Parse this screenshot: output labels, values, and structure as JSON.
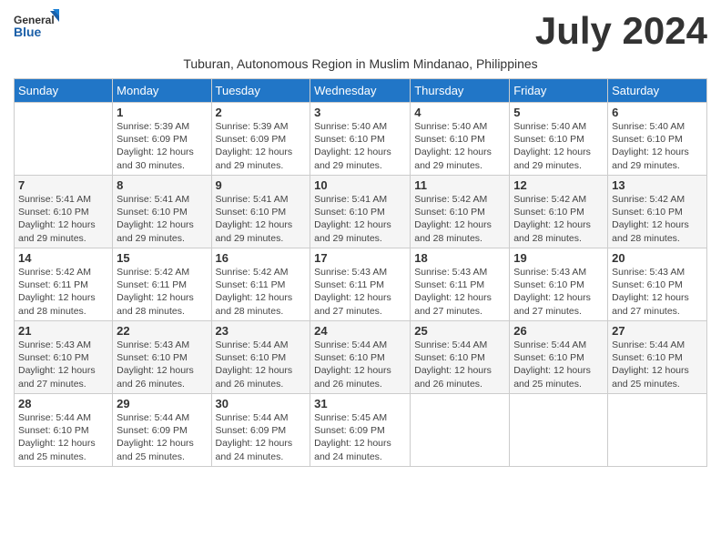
{
  "header": {
    "logo_line1": "General",
    "logo_line2": "Blue",
    "month_title": "July 2024",
    "subtitle": "Tuburan, Autonomous Region in Muslim Mindanao, Philippines"
  },
  "days_of_week": [
    "Sunday",
    "Monday",
    "Tuesday",
    "Wednesday",
    "Thursday",
    "Friday",
    "Saturday"
  ],
  "weeks": [
    [
      {
        "day": "",
        "info": ""
      },
      {
        "day": "1",
        "info": "Sunrise: 5:39 AM\nSunset: 6:09 PM\nDaylight: 12 hours\nand 30 minutes."
      },
      {
        "day": "2",
        "info": "Sunrise: 5:39 AM\nSunset: 6:09 PM\nDaylight: 12 hours\nand 29 minutes."
      },
      {
        "day": "3",
        "info": "Sunrise: 5:40 AM\nSunset: 6:10 PM\nDaylight: 12 hours\nand 29 minutes."
      },
      {
        "day": "4",
        "info": "Sunrise: 5:40 AM\nSunset: 6:10 PM\nDaylight: 12 hours\nand 29 minutes."
      },
      {
        "day": "5",
        "info": "Sunrise: 5:40 AM\nSunset: 6:10 PM\nDaylight: 12 hours\nand 29 minutes."
      },
      {
        "day": "6",
        "info": "Sunrise: 5:40 AM\nSunset: 6:10 PM\nDaylight: 12 hours\nand 29 minutes."
      }
    ],
    [
      {
        "day": "7",
        "info": "Sunrise: 5:41 AM\nSunset: 6:10 PM\nDaylight: 12 hours\nand 29 minutes."
      },
      {
        "day": "8",
        "info": "Sunrise: 5:41 AM\nSunset: 6:10 PM\nDaylight: 12 hours\nand 29 minutes."
      },
      {
        "day": "9",
        "info": "Sunrise: 5:41 AM\nSunset: 6:10 PM\nDaylight: 12 hours\nand 29 minutes."
      },
      {
        "day": "10",
        "info": "Sunrise: 5:41 AM\nSunset: 6:10 PM\nDaylight: 12 hours\nand 29 minutes."
      },
      {
        "day": "11",
        "info": "Sunrise: 5:42 AM\nSunset: 6:10 PM\nDaylight: 12 hours\nand 28 minutes."
      },
      {
        "day": "12",
        "info": "Sunrise: 5:42 AM\nSunset: 6:10 PM\nDaylight: 12 hours\nand 28 minutes."
      },
      {
        "day": "13",
        "info": "Sunrise: 5:42 AM\nSunset: 6:10 PM\nDaylight: 12 hours\nand 28 minutes."
      }
    ],
    [
      {
        "day": "14",
        "info": "Sunrise: 5:42 AM\nSunset: 6:11 PM\nDaylight: 12 hours\nand 28 minutes."
      },
      {
        "day": "15",
        "info": "Sunrise: 5:42 AM\nSunset: 6:11 PM\nDaylight: 12 hours\nand 28 minutes."
      },
      {
        "day": "16",
        "info": "Sunrise: 5:42 AM\nSunset: 6:11 PM\nDaylight: 12 hours\nand 28 minutes."
      },
      {
        "day": "17",
        "info": "Sunrise: 5:43 AM\nSunset: 6:11 PM\nDaylight: 12 hours\nand 27 minutes."
      },
      {
        "day": "18",
        "info": "Sunrise: 5:43 AM\nSunset: 6:11 PM\nDaylight: 12 hours\nand 27 minutes."
      },
      {
        "day": "19",
        "info": "Sunrise: 5:43 AM\nSunset: 6:10 PM\nDaylight: 12 hours\nand 27 minutes."
      },
      {
        "day": "20",
        "info": "Sunrise: 5:43 AM\nSunset: 6:10 PM\nDaylight: 12 hours\nand 27 minutes."
      }
    ],
    [
      {
        "day": "21",
        "info": "Sunrise: 5:43 AM\nSunset: 6:10 PM\nDaylight: 12 hours\nand 27 minutes."
      },
      {
        "day": "22",
        "info": "Sunrise: 5:43 AM\nSunset: 6:10 PM\nDaylight: 12 hours\nand 26 minutes."
      },
      {
        "day": "23",
        "info": "Sunrise: 5:44 AM\nSunset: 6:10 PM\nDaylight: 12 hours\nand 26 minutes."
      },
      {
        "day": "24",
        "info": "Sunrise: 5:44 AM\nSunset: 6:10 PM\nDaylight: 12 hours\nand 26 minutes."
      },
      {
        "day": "25",
        "info": "Sunrise: 5:44 AM\nSunset: 6:10 PM\nDaylight: 12 hours\nand 26 minutes."
      },
      {
        "day": "26",
        "info": "Sunrise: 5:44 AM\nSunset: 6:10 PM\nDaylight: 12 hours\nand 25 minutes."
      },
      {
        "day": "27",
        "info": "Sunrise: 5:44 AM\nSunset: 6:10 PM\nDaylight: 12 hours\nand 25 minutes."
      }
    ],
    [
      {
        "day": "28",
        "info": "Sunrise: 5:44 AM\nSunset: 6:10 PM\nDaylight: 12 hours\nand 25 minutes."
      },
      {
        "day": "29",
        "info": "Sunrise: 5:44 AM\nSunset: 6:09 PM\nDaylight: 12 hours\nand 25 minutes."
      },
      {
        "day": "30",
        "info": "Sunrise: 5:44 AM\nSunset: 6:09 PM\nDaylight: 12 hours\nand 24 minutes."
      },
      {
        "day": "31",
        "info": "Sunrise: 5:45 AM\nSunset: 6:09 PM\nDaylight: 12 hours\nand 24 minutes."
      },
      {
        "day": "",
        "info": ""
      },
      {
        "day": "",
        "info": ""
      },
      {
        "day": "",
        "info": ""
      }
    ]
  ]
}
